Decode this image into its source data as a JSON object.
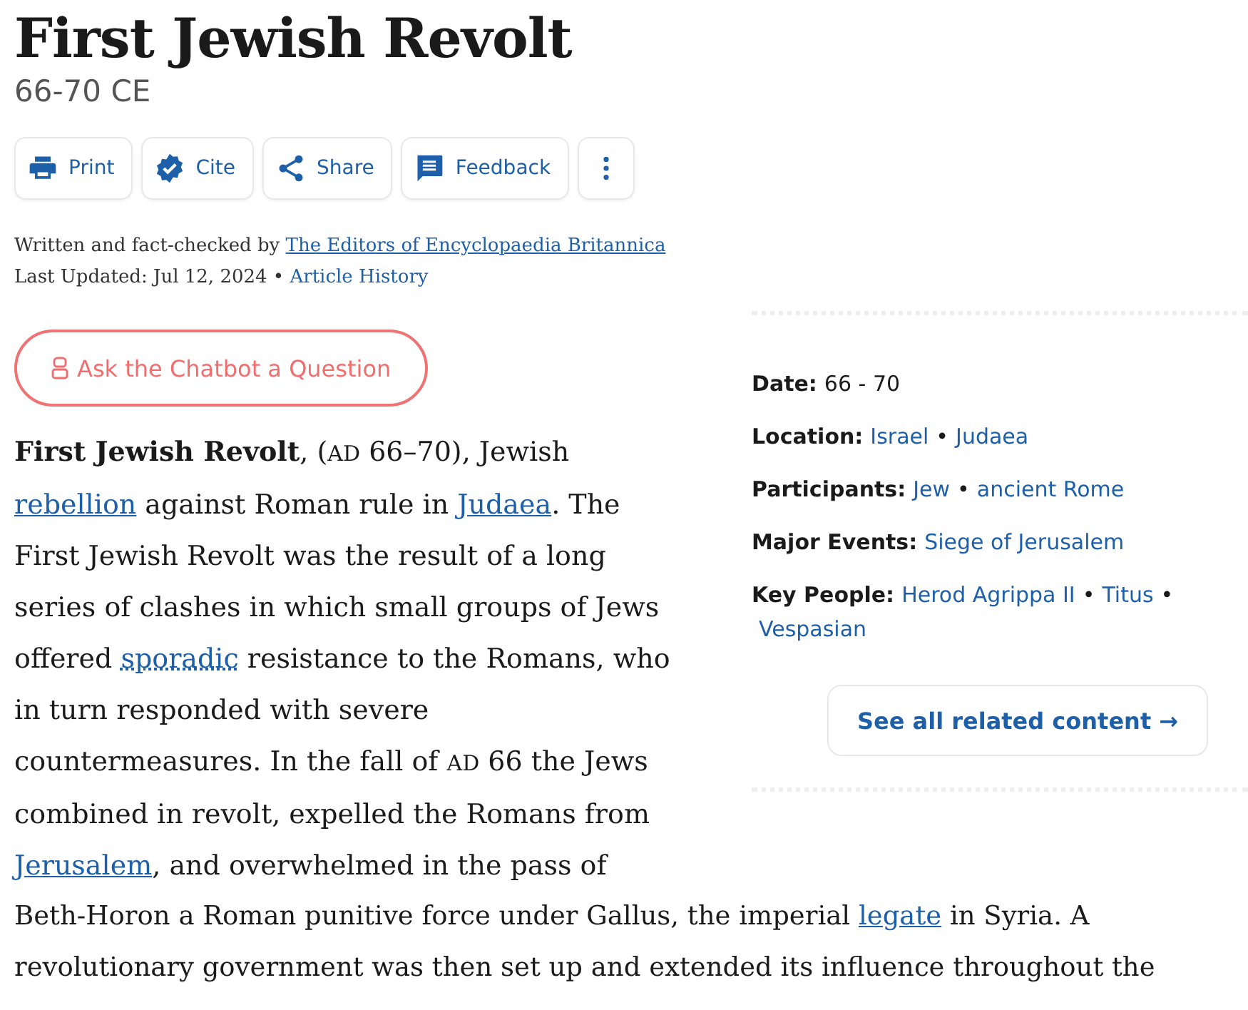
{
  "title": "First Jewish Revolt",
  "subtitle": "66-70 CE",
  "toolbar": [
    {
      "kind": "print",
      "label": "Print"
    },
    {
      "kind": "cite",
      "label": "Cite"
    },
    {
      "kind": "share",
      "label": "Share"
    },
    {
      "kind": "feedback",
      "label": "Feedback"
    },
    {
      "kind": "more"
    }
  ],
  "byline": {
    "prefix": "Written and fact-checked by",
    "author": "The Editors of Encyclopaedia Britannica",
    "updated": "Last Updated: Jul 12, 2024",
    "separator": "•",
    "history": "Article History"
  },
  "chatbot_button": "Ask the Chatbot a Question",
  "facts": [
    {
      "label": "Date:",
      "values": [
        {
          "kind": "text",
          "text": "66 - 70"
        }
      ]
    },
    {
      "label": "Location:",
      "values": [
        {
          "kind": "link",
          "text": "Israel"
        },
        {
          "kind": "link",
          "text": "Judaea"
        }
      ]
    },
    {
      "label": "Participants:",
      "values": [
        {
          "kind": "link",
          "text": "Jew"
        },
        {
          "kind": "link",
          "text": "ancient Rome"
        }
      ]
    },
    {
      "label": "Major Events:",
      "values": [
        {
          "kind": "link",
          "text": "Siege of Jerusalem"
        }
      ]
    },
    {
      "label": "Key People:",
      "values": [
        {
          "kind": "link",
          "text": "Herod Agrippa II"
        },
        {
          "kind": "link",
          "text": "Titus"
        },
        {
          "kind": "link",
          "text": "Vespasian"
        }
      ]
    }
  ],
  "fact_separator": "•",
  "related_button": "See all related content →",
  "paragraph_beside": [
    {
      "kind": "bold",
      "text": "First Jewish Revolt"
    },
    {
      "kind": "text",
      "text": ", ("
    },
    {
      "kind": "smallcaps",
      "text": "AD"
    },
    {
      "kind": "text",
      "text": " 66–70), Jewish "
    },
    {
      "kind": "link",
      "text": "rebellion"
    },
    {
      "kind": "text",
      "text": " against Roman rule in "
    },
    {
      "kind": "link",
      "text": "Judaea"
    },
    {
      "kind": "text",
      "text": ". The First Jewish Revolt was the result of a long series of clashes in which small groups of Jews offered "
    },
    {
      "kind": "term",
      "text": "sporadic"
    },
    {
      "kind": "text",
      "text": " resistance to the Romans, who in turn responded with severe countermeasures. In the fall of "
    },
    {
      "kind": "smallcaps",
      "text": "AD"
    },
    {
      "kind": "text",
      "text": " 66 the Jews combined in revolt, expelled the Romans from "
    },
    {
      "kind": "link",
      "text": "Jerusalem"
    },
    {
      "kind": "text",
      "text": ", and overwhelmed in the pass of"
    }
  ],
  "paragraph_below": [
    {
      "kind": "text",
      "text": "Beth-Horon a Roman punitive force under Gallus, the imperial "
    },
    {
      "kind": "link",
      "text": "legate"
    },
    {
      "kind": "text",
      "text": " in Syria. A revolutionary government was then set up and extended its influence throughout the"
    }
  ]
}
